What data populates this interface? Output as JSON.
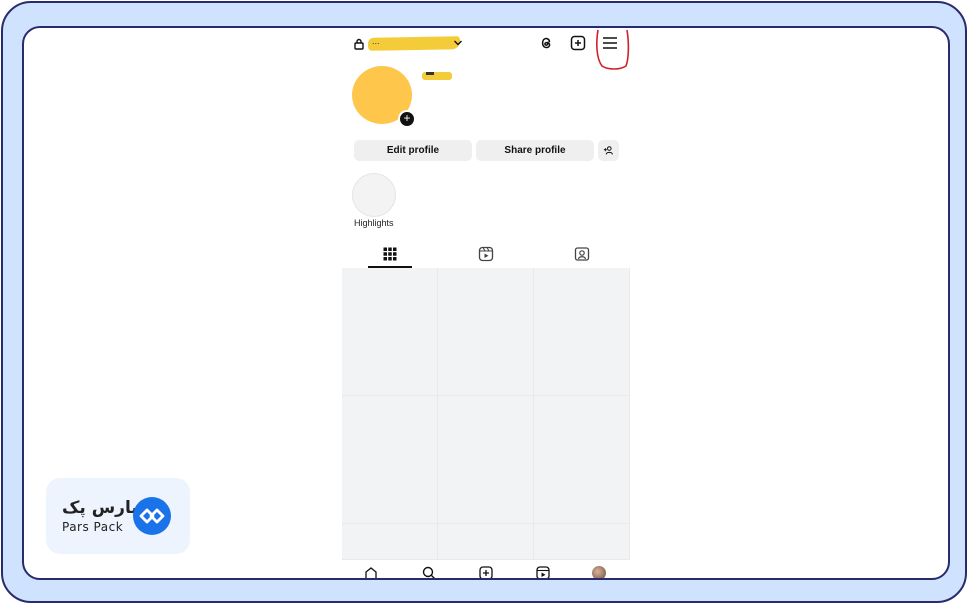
{
  "header": {
    "username_partial": "...",
    "menu_highlight_color": "#d0212b"
  },
  "profile": {
    "edit_label": "Edit profile",
    "share_label": "Share profile"
  },
  "highlights": {
    "label": "Highlights"
  },
  "tabs": [
    {
      "icon": "grid-icon"
    },
    {
      "icon": "reels-icon"
    },
    {
      "icon": "tagged-icon"
    }
  ],
  "bottom_nav": [
    {
      "icon": "home-icon"
    },
    {
      "icon": "search-icon"
    },
    {
      "icon": "create-icon"
    },
    {
      "icon": "reels-icon"
    },
    {
      "icon": "profile-avatar"
    }
  ],
  "brand": {
    "persian": "پارس پک",
    "latin": "Pars Pack",
    "accent": "#1a73e8"
  },
  "colors": {
    "frame_bg": "#cfe3ff",
    "frame_border": "#2a2a6e",
    "redaction_yellow": "#f4cc3a"
  }
}
